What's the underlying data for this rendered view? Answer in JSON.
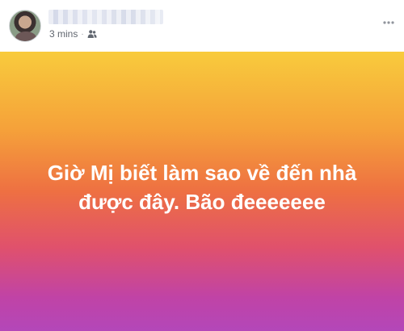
{
  "post": {
    "author_name": "",
    "timestamp": "3 mins",
    "separator": "·",
    "audience_icon": "friends-icon",
    "more_icon": "more-horizontal-icon",
    "status_text": "Giờ Mị biết làm sao về đến nhà được đây. Bão đeeeeeee",
    "background_colors": [
      "#f8cb3c",
      "#f5a13a",
      "#ee7042",
      "#e0516c",
      "#c043a6",
      "#b347b9"
    ],
    "text_color": "#ffffff"
  }
}
